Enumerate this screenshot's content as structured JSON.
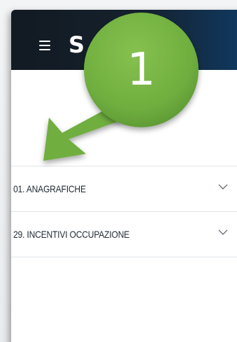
{
  "app": {
    "logo_text": "S",
    "menu_icon": "hamburger-menu-icon"
  },
  "callout": {
    "number": "1",
    "color": "#6fae3f",
    "arrow_color": "#6fae3f"
  },
  "menu": {
    "items": [
      {
        "label": "01. ANAGRAFICHE",
        "icon": "chevron-down-icon"
      },
      {
        "label": "29. INCENTIVI OCCUPAZIONE",
        "icon": "chevron-down-icon"
      }
    ]
  },
  "colors": {
    "topbar": "#15212d",
    "topbar_accent": "#0f3a63",
    "text": "#1f2933",
    "divider": "#e2e4e7"
  }
}
